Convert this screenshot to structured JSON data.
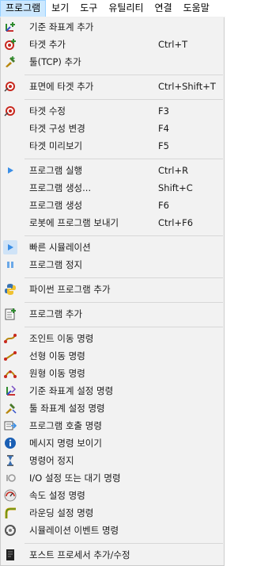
{
  "menubar": [
    {
      "label": "프로그램",
      "active": true
    },
    {
      "label": "보기"
    },
    {
      "label": "도구"
    },
    {
      "label": "유틸리티"
    },
    {
      "label": "연결"
    },
    {
      "label": "도움말"
    }
  ],
  "items": [
    {
      "label": "기준 좌표계 추가",
      "shortcut": "",
      "icon": "add-reference-frame-icon"
    },
    {
      "label": "타겟 추가",
      "shortcut": "Ctrl+T",
      "icon": "add-target-icon"
    },
    {
      "label": "툴(TCP) 추가",
      "shortcut": "",
      "icon": "add-tool-icon"
    },
    {
      "label": "표면에 타겟 추가",
      "shortcut": "Ctrl+Shift+T",
      "icon": "target-on-surface-icon"
    },
    {
      "label": "타겟 수정",
      "shortcut": "F3",
      "icon": "target-icon"
    },
    {
      "label": "타겟 구성 변경",
      "shortcut": "F4",
      "icon": ""
    },
    {
      "label": "타겟 미리보기",
      "shortcut": "F5",
      "icon": ""
    },
    {
      "label": "프로그램 실행",
      "shortcut": "Ctrl+R",
      "icon": "play-icon"
    },
    {
      "label": "프로그램 생성...",
      "shortcut": "Shift+C",
      "icon": ""
    },
    {
      "label": "프로그램 생성",
      "shortcut": "F6",
      "icon": ""
    },
    {
      "label": "로봇에 프로그램 보내기",
      "shortcut": "Ctrl+F6",
      "icon": ""
    },
    {
      "label": "빠른 시뮬레이션",
      "shortcut": "",
      "icon": "fast-simulation-icon"
    },
    {
      "label": "프로그램 정지",
      "shortcut": "",
      "icon": "pause-icon"
    },
    {
      "label": "파이썬 프로그램 추가",
      "shortcut": "",
      "icon": "python-icon"
    },
    {
      "label": "프로그램 추가",
      "shortcut": "",
      "icon": "add-program-icon"
    },
    {
      "label": "조인트 이동 명령",
      "shortcut": "",
      "icon": "joint-move-icon"
    },
    {
      "label": "선형 이동 명령",
      "shortcut": "",
      "icon": "linear-move-icon"
    },
    {
      "label": "원형 이동 명령",
      "shortcut": "",
      "icon": "circular-move-icon"
    },
    {
      "label": "기준 좌표계 설정 명령",
      "shortcut": "",
      "icon": "set-reference-frame-icon"
    },
    {
      "label": "툴 좌표계 설정 명령",
      "shortcut": "",
      "icon": "set-tool-frame-icon"
    },
    {
      "label": "프로그램 호출 명령",
      "shortcut": "",
      "icon": "program-call-icon"
    },
    {
      "label": "메시지 명령 보이기",
      "shortcut": "",
      "icon": "info-icon"
    },
    {
      "label": "명령어 정지",
      "shortcut": "",
      "icon": "hourglass-icon"
    },
    {
      "label": "I/O 설정 또는 대기 명령",
      "shortcut": "",
      "icon": "io-icon"
    },
    {
      "label": "속도 설정 명령",
      "shortcut": "",
      "icon": "speedometer-icon"
    },
    {
      "label": "라운딩 설정 명령",
      "shortcut": "",
      "icon": "rounding-icon"
    },
    {
      "label": "시뮬레이션 이벤트 명령",
      "shortcut": "",
      "icon": "simulation-event-icon"
    },
    {
      "label": "포스트 프로세서 추가/수정",
      "shortcut": "",
      "icon": "post-processor-icon"
    }
  ],
  "colors": {
    "menubar_active_bg": "#cce8ff",
    "menu_bg": "#f2f2f2",
    "target_red": "#c8281e",
    "play_blue": "#3a8ee6",
    "info_blue": "#1a5fb4"
  }
}
